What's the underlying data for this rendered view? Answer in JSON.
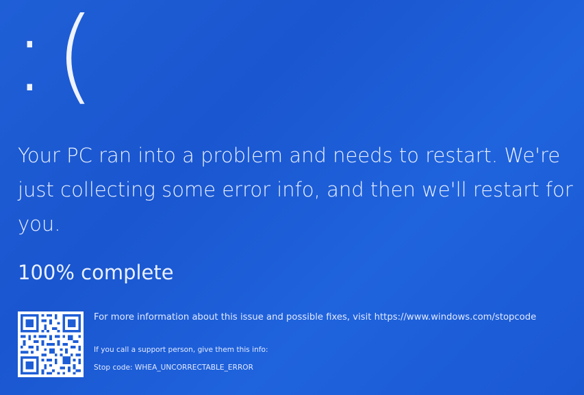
{
  "screen": {
    "background_color": "#1d5dd6",
    "text_color": "#eaf0ff",
    "emoticon": ":(",
    "message": "Your PC ran into a problem and needs to restart. We're just collecting some error info, and then we'll restart for you.",
    "progress_text": "100% complete",
    "more_info": "For more information about this issue and possible fixes, visit https://www.windows.com/stopcode",
    "support_prompt": "If you call a support person, give them this info:",
    "stop_code": "Stop code: WHEA_UNCORRECTABLE_ERROR",
    "qr_icon": "qr-code-icon"
  }
}
